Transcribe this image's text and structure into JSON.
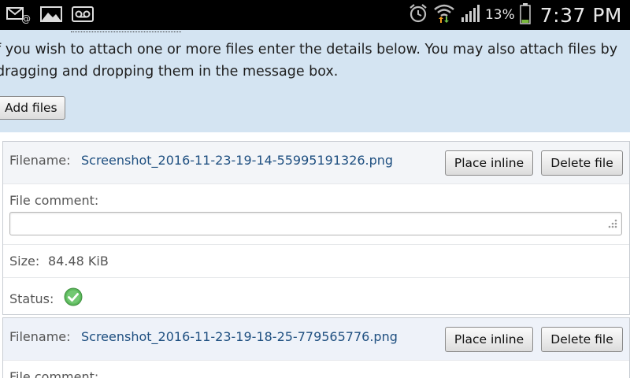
{
  "statusbar": {
    "left_icons": [
      "email-icon",
      "gallery-icon",
      "voicemail-icon"
    ],
    "right_icons": [
      "alarm-icon",
      "wifi-icon",
      "signal-icon",
      "battery-icon"
    ],
    "battery_percent": "13%",
    "time": "7:37 PM"
  },
  "intro": {
    "line1": "f you wish to attach one or more files enter the details below. You may also attach files by",
    "line2": "dragging and dropping them in the message box.",
    "add_files_label": "Add files"
  },
  "files": [
    {
      "filename_label": "Filename:",
      "filename": "Screenshot_2016-11-23-19-14-55995191326.png",
      "place_inline_label": "Place inline",
      "delete_label": "Delete file",
      "comment_label": "File comment:",
      "comment_value": "",
      "size_label": "Size:",
      "size_value": "84.48 KiB",
      "status_label": "Status:",
      "status_icon": "check-icon"
    },
    {
      "filename_label": "Filename:",
      "filename": "Screenshot_2016-11-23-19-18-25-779565776.png",
      "place_inline_label": "Place inline",
      "delete_label": "Delete file",
      "comment_label": "File comment:"
    }
  ],
  "colors": {
    "statusbar_bg": "#000000",
    "intro_bg": "#d4e4f2",
    "filename_color": "#1e4f80",
    "status_ok": "#5cb85c"
  }
}
